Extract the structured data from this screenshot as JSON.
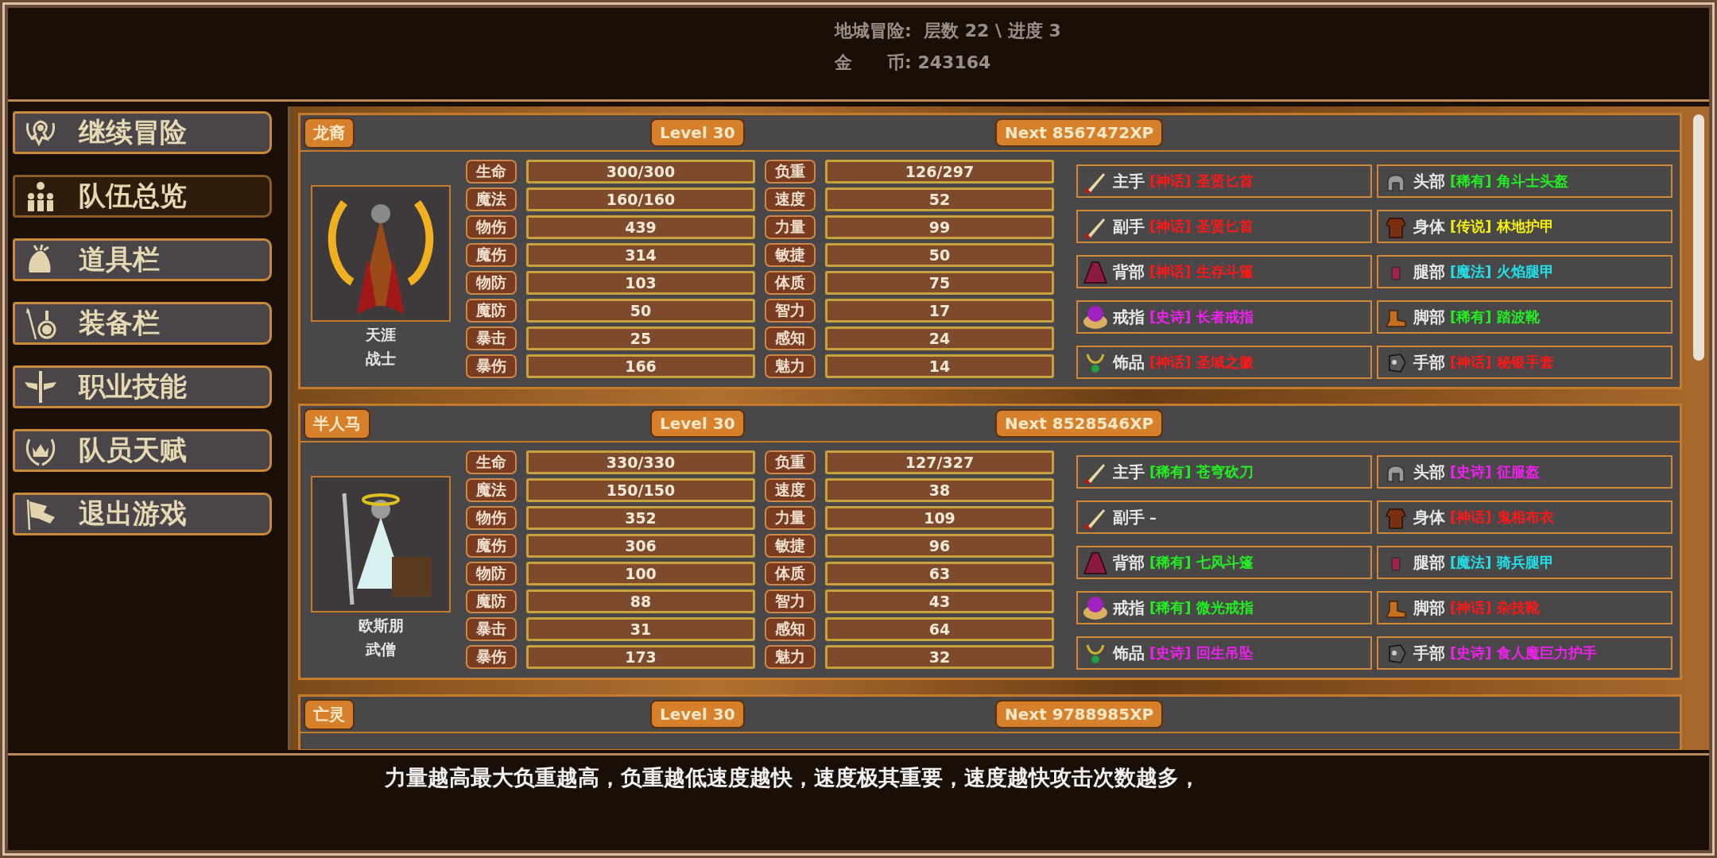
{
  "header": {
    "dungeon": "地城冒险:  层数 22 \\ 进度 3",
    "coins": "金　　币: 243164"
  },
  "menu": [
    {
      "label": "继续冒险",
      "selected": false
    },
    {
      "label": "队伍总览",
      "selected": true
    },
    {
      "label": "道具栏",
      "selected": false
    },
    {
      "label": "装备栏",
      "selected": false
    },
    {
      "label": "职业技能",
      "selected": false
    },
    {
      "label": "队员天赋",
      "selected": false
    },
    {
      "label": "退出游戏",
      "selected": false
    }
  ],
  "characters": [
    {
      "race": "龙裔",
      "level": "Level 30",
      "next_xp": "Next 8567472XP",
      "name": "天涯",
      "class": "战士",
      "stats": [
        {
          "label": "生命",
          "value": "300/300"
        },
        {
          "label": "负重",
          "value": "126/297"
        },
        {
          "label": "魔法",
          "value": "160/160"
        },
        {
          "label": "速度",
          "value": "52"
        },
        {
          "label": "物伤",
          "value": "439"
        },
        {
          "label": "力量",
          "value": "99"
        },
        {
          "label": "魔伤",
          "value": "314"
        },
        {
          "label": "敏捷",
          "value": "50"
        },
        {
          "label": "物防",
          "value": "103"
        },
        {
          "label": "体质",
          "value": "75"
        },
        {
          "label": "魔防",
          "value": "50"
        },
        {
          "label": "智力",
          "value": "17"
        },
        {
          "label": "暴击",
          "value": "25"
        },
        {
          "label": "感知",
          "value": "24"
        },
        {
          "label": "暴伤",
          "value": "166"
        },
        {
          "label": "魅力",
          "value": "14"
        }
      ],
      "equipment": [
        {
          "slot": "主手",
          "item": "[神话] 圣贤匕首",
          "color": "#ff1818"
        },
        {
          "slot": "头部",
          "item": "[稀有] 角斗士头盔",
          "color": "#22ee22"
        },
        {
          "slot": "副手",
          "item": "[神话] 圣贤匕首",
          "color": "#ff1818"
        },
        {
          "slot": "身体",
          "item": "[传说] 林地护甲",
          "color": "#f2ee10"
        },
        {
          "slot": "背部",
          "item": "[神话] 生存斗篷",
          "color": "#ff1818"
        },
        {
          "slot": "腿部",
          "item": "[魔法] 火焰腿甲",
          "color": "#22e0e8"
        },
        {
          "slot": "戒指",
          "item": "[史诗] 长者戒指",
          "color": "#f020f0"
        },
        {
          "slot": "脚部",
          "item": "[稀有] 踏波靴",
          "color": "#22ee22"
        },
        {
          "slot": "饰品",
          "item": "[神话] 圣域之徽",
          "color": "#ff1818"
        },
        {
          "slot": "手部",
          "item": "[神话] 秘银手套",
          "color": "#ff1818"
        }
      ]
    },
    {
      "race": "半人马",
      "level": "Level 30",
      "next_xp": "Next 8528546XP",
      "name": "欧斯朋",
      "class": "武僧",
      "stats": [
        {
          "label": "生命",
          "value": "330/330"
        },
        {
          "label": "负重",
          "value": "127/327"
        },
        {
          "label": "魔法",
          "value": "150/150"
        },
        {
          "label": "速度",
          "value": "38"
        },
        {
          "label": "物伤",
          "value": "352"
        },
        {
          "label": "力量",
          "value": "109"
        },
        {
          "label": "魔伤",
          "value": "306"
        },
        {
          "label": "敏捷",
          "value": "96"
        },
        {
          "label": "物防",
          "value": "100"
        },
        {
          "label": "体质",
          "value": "63"
        },
        {
          "label": "魔防",
          "value": "88"
        },
        {
          "label": "智力",
          "value": "43"
        },
        {
          "label": "暴击",
          "value": "31"
        },
        {
          "label": "感知",
          "value": "64"
        },
        {
          "label": "暴伤",
          "value": "173"
        },
        {
          "label": "魅力",
          "value": "32"
        }
      ],
      "equipment": [
        {
          "slot": "主手",
          "item": "[稀有] 苍穹砍刀",
          "color": "#22ee22"
        },
        {
          "slot": "头部",
          "item": "[史诗] 征服盔",
          "color": "#f020f0"
        },
        {
          "slot": "副手",
          "item": "–",
          "color": "#e6e6e6"
        },
        {
          "slot": "身体",
          "item": "[神话] 鬼相布衣",
          "color": "#ff1818"
        },
        {
          "slot": "背部",
          "item": "[稀有] 七风斗篷",
          "color": "#22ee22"
        },
        {
          "slot": "腿部",
          "item": "[魔法] 骑兵腿甲",
          "color": "#22e0e8"
        },
        {
          "slot": "戒指",
          "item": "[稀有] 微光戒指",
          "color": "#22ee22"
        },
        {
          "slot": "脚部",
          "item": "[神话] 杂技靴",
          "color": "#ff1818"
        },
        {
          "slot": "饰品",
          "item": "[史诗] 回生吊坠",
          "color": "#f020f0"
        },
        {
          "slot": "手部",
          "item": "[史诗] 食人魔巨力护手",
          "color": "#f020f0"
        }
      ]
    },
    {
      "race": "亡灵",
      "level": "Level 30",
      "next_xp": "Next 9788985XP"
    }
  ],
  "hint": "力量越高最大负重越高，负重越低速度越快，速度极其重要，速度越快攻击次数越多，"
}
